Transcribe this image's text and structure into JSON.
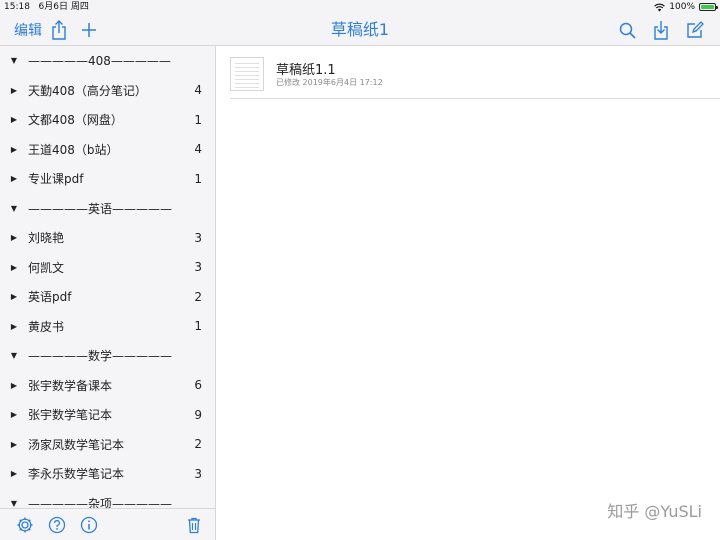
{
  "status_bar": {
    "time": "15:18",
    "date": "6月6日 周四",
    "battery": "100%",
    "battery_level": 1.0
  },
  "navbar": {
    "edit_label": "编辑",
    "title": "草稿纸1",
    "icons": [
      "share-icon",
      "plus-icon",
      "search-icon",
      "download-icon",
      "compose-icon"
    ],
    "accent_color": "#2f7fd8"
  },
  "sidebar": {
    "items": [
      {
        "label": "—————408—————",
        "count": "",
        "group": true,
        "arrow": "▼"
      },
      {
        "label": "天勤408（高分笔记）",
        "count": "4",
        "group": false,
        "arrow": "▶"
      },
      {
        "label": "文都408（网盘）",
        "count": "1",
        "group": false,
        "arrow": "▶"
      },
      {
        "label": "王道408（b站）",
        "count": "4",
        "group": false,
        "arrow": "▶"
      },
      {
        "label": "专业课pdf",
        "count": "1",
        "group": false,
        "arrow": "▶"
      },
      {
        "label": "—————英语—————",
        "count": "",
        "group": true,
        "arrow": "▼"
      },
      {
        "label": "刘晓艳",
        "count": "3",
        "group": false,
        "arrow": "▶"
      },
      {
        "label": "何凯文",
        "count": "3",
        "group": false,
        "arrow": "▶"
      },
      {
        "label": "英语pdf",
        "count": "2",
        "group": false,
        "arrow": "▶"
      },
      {
        "label": "黄皮书",
        "count": "1",
        "group": false,
        "arrow": "▶"
      },
      {
        "label": "—————数学—————",
        "count": "",
        "group": true,
        "arrow": "▼"
      },
      {
        "label": "张宇数学备课本",
        "count": "6",
        "group": false,
        "arrow": "▶"
      },
      {
        "label": "张宇数学笔记本",
        "count": "9",
        "group": false,
        "arrow": "▶"
      },
      {
        "label": "汤家凤数学笔记本",
        "count": "2",
        "group": false,
        "arrow": "▶"
      },
      {
        "label": "李永乐数学笔记本",
        "count": "3",
        "group": false,
        "arrow": "▶"
      },
      {
        "label": "—————杂项—————",
        "count": "",
        "group": true,
        "arrow": "▼"
      }
    ],
    "bottom_icons": [
      "settings-icon",
      "help-icon",
      "info-icon",
      "trash-icon"
    ]
  },
  "document": {
    "title": "草稿纸1.1",
    "modified": "已修改 2019年6月4日 17:12"
  },
  "watermark": "知乎 @YuSLi"
}
